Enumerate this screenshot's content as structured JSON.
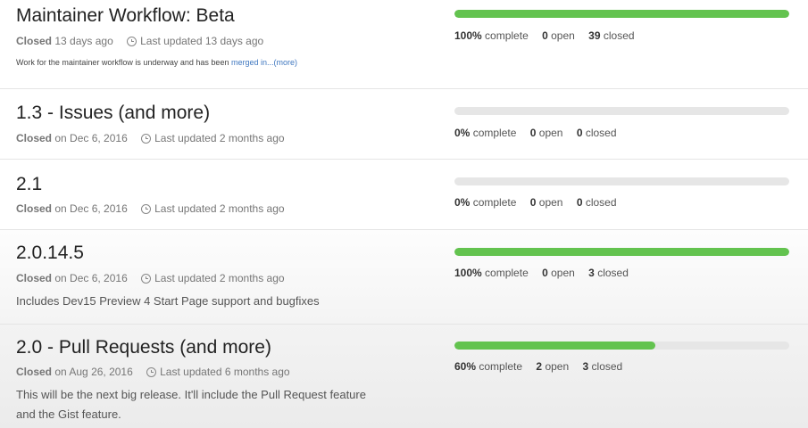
{
  "colors": {
    "progress_fill": "#63c34f",
    "progress_track": "#e6e6e6",
    "link": "#4078c0"
  },
  "milestones": [
    {
      "title": "Maintainer Workflow: Beta",
      "state": "Closed",
      "closed_when": "13 days ago",
      "updated": "Last updated 13 days ago",
      "description": "Work for the maintainer workflow is underway and has been ",
      "description_link": "merged in...",
      "description_more": "(more)",
      "progress": 100,
      "percent_label": "100%",
      "complete_label": "complete",
      "open_count": "0",
      "open_label": "open",
      "closed_count": "39",
      "closed_label": "closed"
    },
    {
      "title": "1.3 - Issues (and more)",
      "state": "Closed",
      "closed_when": "on Dec 6, 2016",
      "updated": "Last updated 2 months ago",
      "progress": 0,
      "percent_label": "0%",
      "complete_label": "complete",
      "open_count": "0",
      "open_label": "open",
      "closed_count": "0",
      "closed_label": "closed"
    },
    {
      "title": "2.1",
      "state": "Closed",
      "closed_when": "on Dec 6, 2016",
      "updated": "Last updated 2 months ago",
      "progress": 0,
      "percent_label": "0%",
      "complete_label": "complete",
      "open_count": "0",
      "open_label": "open",
      "closed_count": "0",
      "closed_label": "closed"
    },
    {
      "title": "2.0.14.5",
      "state": "Closed",
      "closed_when": "on Dec 6, 2016",
      "updated": "Last updated 2 months ago",
      "description": "Includes Dev15 Preview 4 Start Page support and bugfixes",
      "progress": 100,
      "percent_label": "100%",
      "complete_label": "complete",
      "open_count": "0",
      "open_label": "open",
      "closed_count": "3",
      "closed_label": "closed"
    },
    {
      "title": "2.0 - Pull Requests (and more)",
      "state": "Closed",
      "closed_when": "on Aug 26, 2016",
      "updated": "Last updated 6 months ago",
      "description_line1": "This will be the next big release. It'll include the Pull Request feature",
      "description_line2": "and the Gist feature.",
      "progress": 60,
      "percent_label": "60%",
      "complete_label": "complete",
      "open_count": "2",
      "open_label": "open",
      "closed_count": "3",
      "closed_label": "closed"
    }
  ]
}
